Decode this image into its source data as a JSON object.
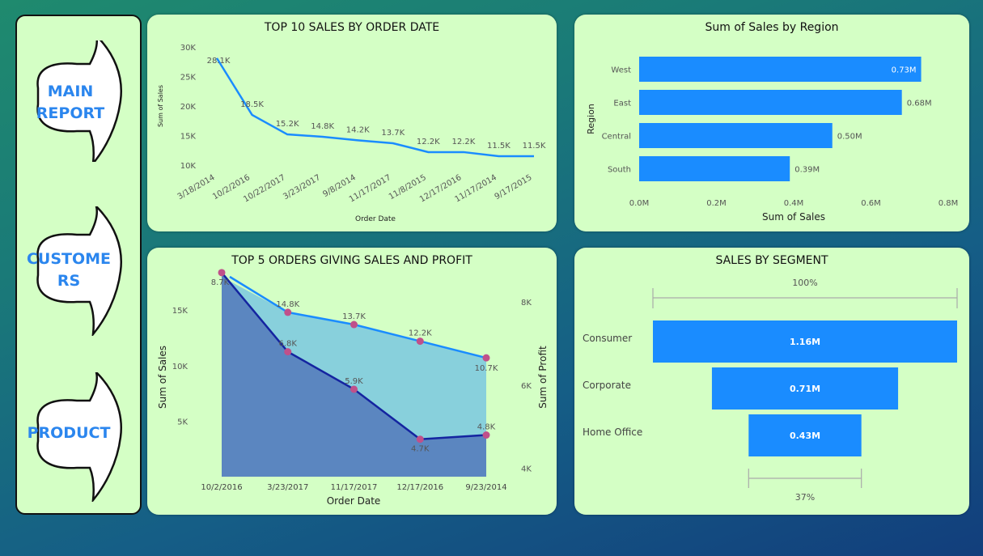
{
  "nav": {
    "buttons": [
      {
        "label_line1": "MAIN",
        "label_line2": "REPORT"
      },
      {
        "label_line1": "CUSTOME",
        "label_line2": "RS"
      },
      {
        "label_line1": "PRODUCT",
        "label_line2": ""
      }
    ]
  },
  "colors": {
    "card_bg": "#d4ffc5",
    "bar_blue": "#1a8cff",
    "line_blue": "#1a8cff",
    "dark_line": "#1424a0",
    "marker_pink": "#c0508a",
    "nav_text": "#2b86ee"
  },
  "chart_data": [
    {
      "type": "line",
      "title": "TOP 10 SALES BY ORDER DATE",
      "xlabel": "Order Date",
      "ylabel": "Sum of Sales",
      "x": [
        "3/18/2014",
        "10/2/2016",
        "10/22/2017",
        "3/23/2017",
        "9/8/2014",
        "11/17/2017",
        "11/8/2015",
        "12/17/2016",
        "11/17/2014",
        "9/17/2015"
      ],
      "values": [
        28.1,
        18.5,
        15.2,
        14.8,
        14.2,
        13.7,
        12.2,
        12.2,
        11.5,
        11.5
      ],
      "data_labels": [
        "28.1K",
        "18.5K",
        "15.2K",
        "14.8K",
        "14.2K",
        "13.7K",
        "12.2K",
        "12.2K",
        "11.5K",
        "11.5K"
      ],
      "y_ticks": [
        "30K",
        "25K",
        "20K",
        "15K",
        "10K"
      ],
      "ylim": [
        10,
        30
      ]
    },
    {
      "type": "bar",
      "orientation": "horizontal",
      "title": "Sum of Sales by Region",
      "xlabel": "Sum of Sales",
      "ylabel": "Region",
      "categories": [
        "West",
        "East",
        "Central",
        "South"
      ],
      "values": [
        0.73,
        0.68,
        0.5,
        0.39
      ],
      "data_labels": [
        "0.73M",
        "0.68M",
        "0.50M",
        "0.39M"
      ],
      "x_ticks": [
        "0.0M",
        "0.2M",
        "0.4M",
        "0.6M",
        "0.8M"
      ],
      "xlim": [
        0,
        0.8
      ]
    },
    {
      "type": "area",
      "title": "TOP 5 ORDERS GIVING SALES AND PROFIT",
      "xlabel": "Order Date",
      "ylabel": "Sum of Sales",
      "y2label": "Sum of Profit",
      "categories": [
        "10/2/2016",
        "3/23/2017",
        "11/17/2017",
        "12/17/2016",
        "9/23/2014"
      ],
      "series": [
        {
          "name": "Sum of Sales",
          "values": [
            18.5,
            14.8,
            13.7,
            12.2,
            10.7
          ],
          "labels": [
            "",
            "14.8K",
            "13.7K",
            "12.2K",
            "10.7K"
          ]
        },
        {
          "name": "Sum of Profit",
          "values": [
            8.7,
            6.8,
            5.9,
            4.7,
            4.8
          ],
          "labels": [
            "8.7K",
            "6.8K",
            "5.9K",
            "4.7K",
            "4.8K"
          ]
        }
      ],
      "y_ticks": [
        "15K",
        "10K",
        "5K"
      ],
      "y2_ticks": [
        "8K",
        "6K",
        "4K"
      ],
      "ylim": [
        0,
        18
      ],
      "y2lim": [
        3.8,
        8.6
      ]
    },
    {
      "type": "funnel",
      "title": "SALES BY SEGMENT",
      "categories": [
        "Consumer",
        "Corporate",
        "Home Office"
      ],
      "values": [
        1.16,
        0.71,
        0.43
      ],
      "data_labels": [
        "1.16M",
        "0.71M",
        "0.43M"
      ],
      "top_pct": "100%",
      "bottom_pct": "37%"
    }
  ]
}
